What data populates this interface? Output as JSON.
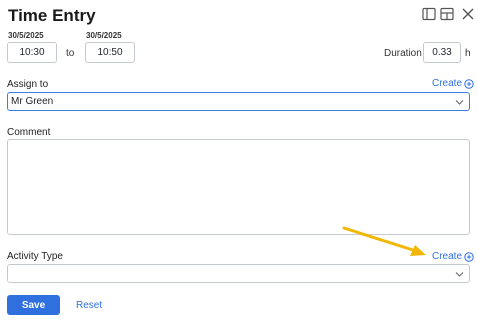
{
  "header": {
    "title": "Time Entry",
    "icons": [
      "sidebar-panel-icon",
      "layout-icon",
      "close-icon"
    ]
  },
  "time": {
    "start_date": "30/5/2025",
    "end_date": "30/5/2025",
    "start_time": "10:30",
    "end_time": "10:50",
    "to_label": "to",
    "duration_label": "Duration",
    "duration_value": "0.33",
    "duration_unit": "h"
  },
  "assign": {
    "label": "Assign to",
    "create_label": "Create",
    "value": "Mr Green"
  },
  "comment": {
    "label": "Comment",
    "value": ""
  },
  "activity": {
    "label": "Activity Type",
    "create_label": "Create",
    "value": ""
  },
  "actions": {
    "save_label": "Save",
    "reset_label": "Reset"
  },
  "colors": {
    "accent": "#2f6fde",
    "annotation_arrow": "#f2b705"
  }
}
